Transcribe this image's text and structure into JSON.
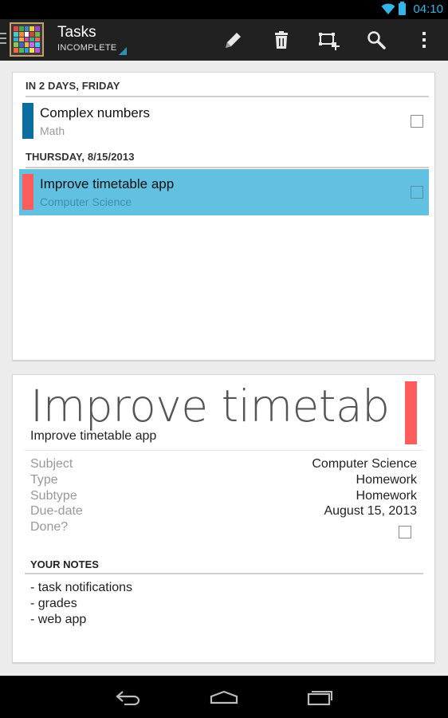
{
  "status_bar": {
    "time": "04:10"
  },
  "action_bar": {
    "title": "Tasks",
    "subtitle": "INCOMPLETE",
    "actions": [
      {
        "name": "edit-button",
        "icon": "pencil-icon"
      },
      {
        "name": "delete-button",
        "icon": "trash-icon"
      },
      {
        "name": "add-task-button",
        "icon": "add-item-icon"
      },
      {
        "name": "search-button",
        "icon": "search-icon"
      },
      {
        "name": "overflow-menu-button",
        "icon": "overflow-icon"
      }
    ]
  },
  "task_list": {
    "sections": [
      {
        "header": "IN 2 DAYS, FRIDAY",
        "tasks": [
          {
            "title": "Complex numbers",
            "subject": "Math",
            "color": "#0c6d9f",
            "done": false,
            "selected": false
          }
        ]
      },
      {
        "header": "THURSDAY, 8/15/2013",
        "tasks": [
          {
            "title": "Improve timetable app",
            "subject": "Computer Science",
            "color": "#ff5d5d",
            "done": false,
            "selected": true
          }
        ]
      }
    ]
  },
  "detail": {
    "big_title": "Improve timetable app",
    "name": "Improve timetable app",
    "color": "#ff5d5d",
    "properties": [
      {
        "label": "Subject",
        "value": "Computer Science"
      },
      {
        "label": "Type",
        "value": "Homework"
      },
      {
        "label": "Subtype",
        "value": "Homework"
      },
      {
        "label": "Due-date",
        "value": "August 15, 2013"
      },
      {
        "label": "Done?",
        "value": ""
      }
    ],
    "notes_header": "YOUR NOTES",
    "notes": [
      "- task notifications",
      "- grades",
      "- web app"
    ]
  },
  "colors": {
    "accent": "#33b5e5",
    "selected_row": "#62c1e1",
    "action_bar": "#212121"
  }
}
